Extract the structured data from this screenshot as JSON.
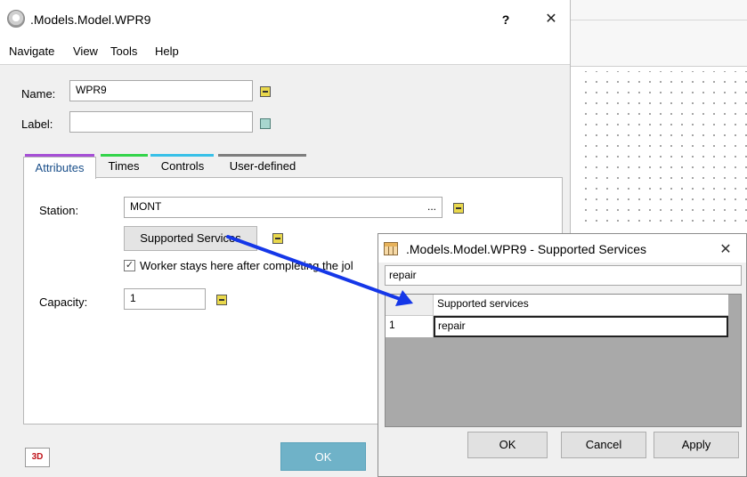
{
  "main_window": {
    "title": ".Models.Model.WPR9",
    "help_glyph": "?",
    "close_glyph": "✕"
  },
  "menu": [
    "Navigate",
    "View",
    "Tools",
    "Help"
  ],
  "fields": {
    "name_label": "Name:",
    "name_value": "WPR9",
    "label_label": "Label:",
    "label_value": ""
  },
  "tabs": [
    {
      "label": "Attributes",
      "color": "#a64fd6"
    },
    {
      "label": "Times",
      "color": "#33d44a"
    },
    {
      "label": "Controls",
      "color": "#38c0e8"
    },
    {
      "label": "User-defined",
      "color": "#7d7d7d"
    }
  ],
  "attributes": {
    "station_label": "Station:",
    "station_value": "MONT",
    "browse_glyph": "...",
    "supported_services_button": "Supported Services",
    "checkbox_checked": true,
    "checkbox_label": "Worker stays here after completing the jol",
    "capacity_label": "Capacity:",
    "capacity_value": "1"
  },
  "footer": {
    "three_d_label": "3D",
    "ok_label": "OK"
  },
  "sub_dialog": {
    "title": ".Models.Model.WPR9 - Supported Services",
    "close_glyph": "✕",
    "input_value": "repair",
    "column_header": "Supported services",
    "rows": [
      {
        "num": "1",
        "value": "repair"
      }
    ],
    "ok_label": "OK",
    "cancel_label": "Cancel",
    "apply_label": "Apply"
  },
  "colors": {
    "ok_button": "#6fb2c8",
    "arrow": "#1537e8",
    "indicator_yellow": "#e9d84c",
    "indicator_teal": "#a7d7cf"
  }
}
